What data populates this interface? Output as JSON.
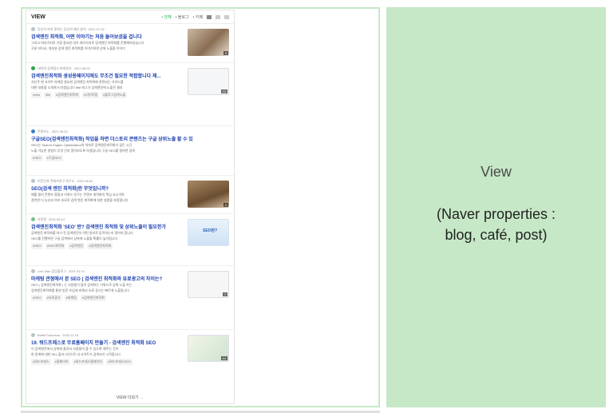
{
  "panel": {
    "title": "VIEW",
    "filter_all": "• 전체",
    "filter_blog": "• 블로그",
    "filter_cafe": "• 카페",
    "more": "VIEW 더보기 →"
  },
  "items": [
    {
      "source": "당신이 보지 못하는 당신의 재산 분석",
      "date": "2021.07.02",
      "title": "검색엔진 최적화, 어떤 이야기는 처음 들어보셨을 겁니다",
      "desc1": "그리고 여러가지로 가장 중요한 내가 여러가지로 검색엔진 최적화를 진행해보았습니다",
      "desc2": "구분 지어서, 대부분 검색 엔진 최적화를 이야기하면 상위 노출을 이야기",
      "tags": [],
      "thumb": "3"
    },
    {
      "source": "네이버 검색광고 파워링크",
      "date": "2021.08.03",
      "title": "검색엔진최적화 생성용페이지에도 무조건 필요한 적합합니다 제...",
      "desc1": "지난주 맨 사이트 마케팅 중요한 검색엔진 최적화에 관련되는 가이드를",
      "desc2": "대한 내용을 소개해 드리겠습니다 title 태그가 검색엔진에 노출된 결과",
      "tags": [
        "meta",
        "title",
        "#검색엔진최적화",
        "#사이트맵",
        "#블로그검색노출"
      ],
      "thumb": "10"
    },
    {
      "source": "콘텐츠노",
      "date": "2021.06.02",
      "title": "구글SEO(검색엔진최적화) 작업을 하면 더스토리 콘텐츠는 구글 상위노출 할 수 있",
      "desc1": "SEO는 Search Engine Optimization의 약자로 검색엔진최적화가 골든 시간",
      "desc2": "노출 가능한 방법이 무엇 인지 알아보도록 하겠습니다 구글 SEO를 잘하면 검색",
      "tags": [
        "#SEO",
        "#구글SEO"
      ],
      "thumb": ""
    },
    {
      "source": "비전인과 콘테츠연구 연구소",
      "date": "2021.08.02",
      "title": "SEO(검색 엔진 최적화)란 무엇입니까?",
      "desc1": "예를 들어 콘텐츠 품질과 키워드 연구는 콘텐츠 최적화의 핵심 요소이며",
      "desc2": "관련한 더 능성과 여러 호모로 검색 엔진 최적화에 대한 설명을 포함합니다",
      "tags": [],
      "thumb": "4"
    },
    {
      "source": "사랑한",
      "date": "2021.06.14",
      "title": "검색엔진최적화 'SEO' 란? 검색엔진 최적화 및 상위노출이 필요한가",
      "desc1": "검색엔진 최적화를 하기 전 검색엔진이 어떤 원리로 동작하는지 알아야 합니다",
      "desc2": "SEO를 진행하면 구글 검색에서 상위에 노출될 확률이 높아집니다",
      "tags": [
        "#SEO",
        "#SEO최적화",
        "#검색엔진",
        "#검색엔진최적화",
        "#사이트홍보"
      ],
      "thumb": "SEO란?"
    },
    {
      "source": "Link Sale 담당블로그",
      "date": "2021.03.10",
      "title": "마케팅 관점에서 본 SEO ( 검색엔진 최적화와 유료광고의 차이는?",
      "desc1": "SEO ( 검색엔진최적화 ) 는 사람들이 많이 검색하는 키워드로 상위 노출 하는",
      "desc2": "검색엔진최적화를 통한 방문 유입에 비해서 유료 광고는 빠르게 노출됩니다",
      "tags": [
        "#SEO",
        "#유료광고",
        "#마케팅",
        "#검색엔진최적화"
      ],
      "thumb": "7"
    },
    {
      "source": "BetterTomorrow",
      "date": "2020.11.16",
      "title": "19. 워드프레스로 무료홈페이지 만들기 - 검색엔진 최적화 SEO",
      "desc1": "이 검색엔진에서 상위에 올려서 사람들이 볼 수 있도록 해주는 것이",
      "desc2": "한 관계에 대한 SEL 플러그인으로 내 사이트가 검색되기 시작합니다",
      "tags": [
        "#워드프레스",
        "#홈페이지",
        "#워드프레스홈페이지",
        "#워드프레스SEO"
      ],
      "thumb": "44"
    }
  ],
  "right_box": {
    "title": "View",
    "subtitle_line1": "(Naver properties :",
    "subtitle_line2": "blog, café, post)"
  },
  "colors": {
    "right_bg": "#c6e8c6",
    "frame_border": "#c6e8c6",
    "title_link": "#1c3fb0",
    "active_filter": "#19b34b"
  }
}
